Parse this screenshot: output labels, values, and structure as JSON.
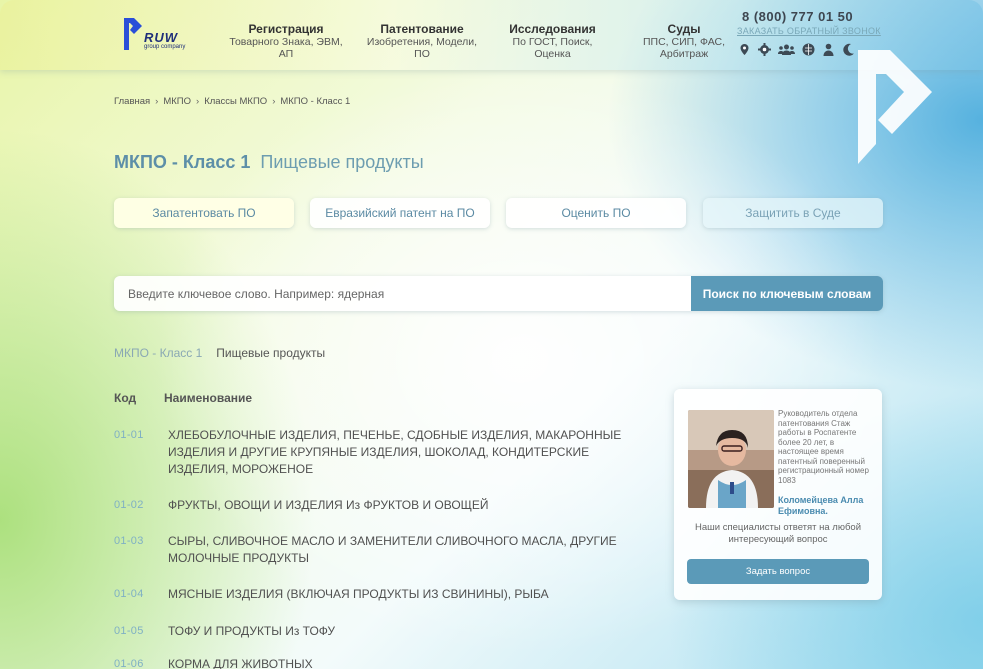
{
  "header": {
    "logo_text": "RUW",
    "logo_sub": "group company",
    "nav": [
      {
        "title": "Регистрация",
        "sub": "Товарного Знака, ЭВМ, АП"
      },
      {
        "title": "Патентование",
        "sub": "Изобретения, Модели, ПО"
      },
      {
        "title": "Исследования",
        "sub": "По ГОСТ, Поиск, Оценка"
      },
      {
        "title": "Суды",
        "sub": "ППС, СИП, ФАС, Арбитраж"
      }
    ],
    "phone": "8 (800) 777 01 50",
    "order_call": "ЗАКАЗАТЬ ОБРАТНЫЙ ЗВОНОК",
    "icons": [
      "location-icon",
      "gear-icon",
      "users-icon",
      "globe-icon",
      "person-icon",
      "moon-icon"
    ]
  },
  "breadcrumb": [
    "Главная",
    "МКПО",
    "Классы МКПО",
    "МКПО - Класс 1"
  ],
  "title": {
    "cls": "МКПО - Класс 1",
    "name": "Пищевые продукты"
  },
  "actions": [
    "Запатентовать ПО",
    "Евразийский патент на ПО",
    "Оценить ПО",
    "Защитить в Суде"
  ],
  "search": {
    "placeholder": "Введите ключевое слово. Например: ядерная",
    "button": "Поиск по ключевым словам"
  },
  "subheading": {
    "cls": "МКПО - Класс 1",
    "name": "Пищевые продукты"
  },
  "table": {
    "headers": {
      "code": "Код",
      "name": "Наименование"
    },
    "rows": [
      {
        "code": "01-01",
        "name": "ХЛЕБОБУЛОЧНЫЕ ИЗДЕЛИЯ, ПЕЧЕНЬЕ, СДОБНЫЕ ИЗДЕЛИЯ, МАКАРОННЫЕ ИЗДЕЛИЯ И ДРУГИЕ КРУПЯНЫЕ ИЗДЕЛИЯ, ШОКОЛАД, КОНДИТЕРСКИЕ ИЗДЕЛИЯ, МОРОЖЕНОЕ"
      },
      {
        "code": "01-02",
        "name": "ФРУКТЫ, ОВОЩИ И ИЗДЕЛИЯ Из ФРУКТОВ И ОВОЩЕЙ"
      },
      {
        "code": "01-03",
        "name": "СЫРЫ, СЛИВОЧНОЕ МАСЛО И ЗАМЕНИТЕЛИ СЛИВОЧНОГО МАСЛА, ДРУГИЕ МОЛОЧНЫЕ ПРОДУКТЫ"
      },
      {
        "code": "01-04",
        "name": "МЯСНЫЕ ИЗДЕЛИЯ (ВКЛЮЧАЯ ПРОДУКТЫ ИЗ СВИНИНЫ), РЫБА"
      },
      {
        "code": "01-05",
        "name": "ТОФУ И ПРОДУКТЫ Из ТОФУ"
      },
      {
        "code": "01-06",
        "name": "КОРМА ДЛЯ ЖИВОТНЫХ"
      }
    ]
  },
  "expert": {
    "description": "Руководитель отдела патентования Стаж работы в Роспатенте более 20 лет, в настоящее время патентный поверенный регистрационный номер 1083",
    "name": "Коломейцева Алла Ефимовна.",
    "note": "Наши специалисты ответят на любой интересующий вопрос",
    "button": "Задать вопрос"
  },
  "colors": {
    "accent": "#5b9ab8",
    "title": "#5d8fa8",
    "code": "#7fb0c4"
  }
}
